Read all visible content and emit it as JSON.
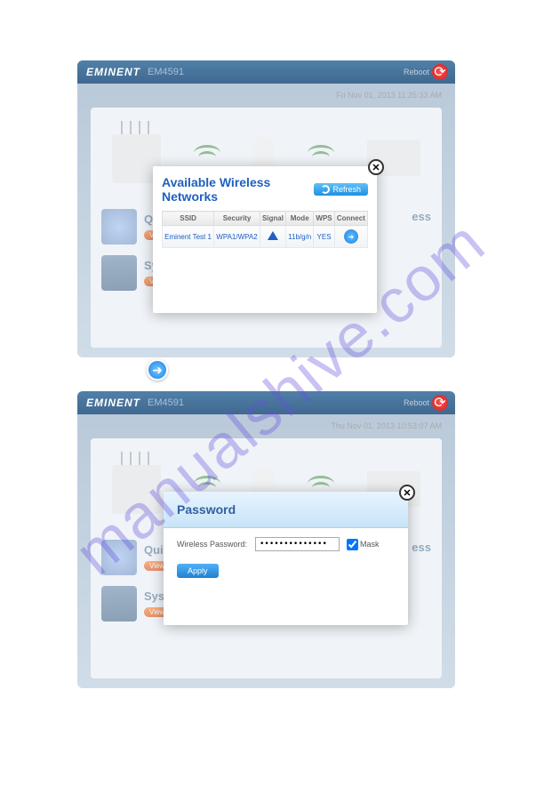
{
  "watermark": "manualshive.com",
  "window1": {
    "brand": "EMINENT",
    "model": "EM4591",
    "reboot": "Reboot",
    "date": "Fri Nov 01, 2013 11:25:33 AM",
    "tiles": {
      "quick": "Quic",
      "quick_badge": "View",
      "system": "Syst",
      "system_badge": "View",
      "wireless": "ess"
    }
  },
  "window2": {
    "brand": "EMINENT",
    "model": "EM4591",
    "reboot": "Reboot",
    "date": "Thu Nov 01, 2013 10:53:07 AM",
    "tiles": {
      "quick": "Quic",
      "quick_badge": "View",
      "system": "Syst",
      "system_badge": "View",
      "wireless": "ess"
    }
  },
  "modal1": {
    "title": "Available Wireless Networks",
    "refresh": "Refresh",
    "headers": {
      "ssid": "SSID",
      "security": "Security",
      "signal": "Signal",
      "mode": "Mode",
      "wps": "WPS",
      "connect": "Connect"
    },
    "row": {
      "ssid": "Eminent Test 1",
      "security": "WPA1/WPA2",
      "mode": "11b/g/n",
      "wps": "YES"
    }
  },
  "modal2": {
    "title": "Password",
    "label": "Wireless Password:",
    "value": "••••••••••••••",
    "mask": "Mask",
    "apply": "Apply"
  },
  "arrow": "➜"
}
